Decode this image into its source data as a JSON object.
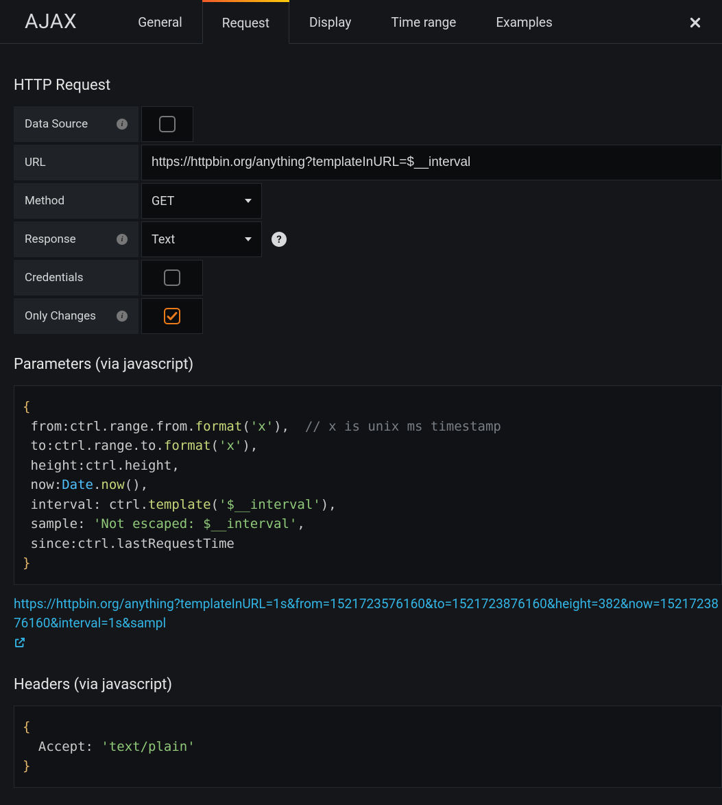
{
  "header": {
    "title": "AJAX",
    "tabs": [
      {
        "label": "General"
      },
      {
        "label": "Request",
        "active": true
      },
      {
        "label": "Display"
      },
      {
        "label": "Time range"
      },
      {
        "label": "Examples"
      }
    ]
  },
  "http_request": {
    "section_title": "HTTP Request",
    "data_source": {
      "label": "Data Source",
      "checked": false
    },
    "url": {
      "label": "URL",
      "value": "https://httpbin.org/anything?templateInURL=$__interval"
    },
    "method": {
      "label": "Method",
      "value": "GET"
    },
    "response": {
      "label": "Response",
      "value": "Text"
    },
    "credentials": {
      "label": "Credentials",
      "checked": false
    },
    "only_changes": {
      "label": "Only Changes",
      "checked": true
    }
  },
  "parameters": {
    "section_title": "Parameters (via javascript)",
    "code": "{\n from:ctrl.range.from.format('x'),  // x is unix ms timestamp\n to:ctrl.range.to.format('x'),\n height:ctrl.height,\n now:Date.now(),\n interval: ctrl.template('$__interval'),\n sample: 'Not escaped: $__interval',\n since:ctrl.lastRequestTime\n}",
    "result_url": "https://httpbin.org/anything?templateInURL=1s&from=1521723576160&to=1521723876160&height=382&now=1521723876160&interval=1s&sampl"
  },
  "headers": {
    "section_title": "Headers (via javascript)",
    "code": "{\n  Accept: 'text/plain'\n}"
  }
}
